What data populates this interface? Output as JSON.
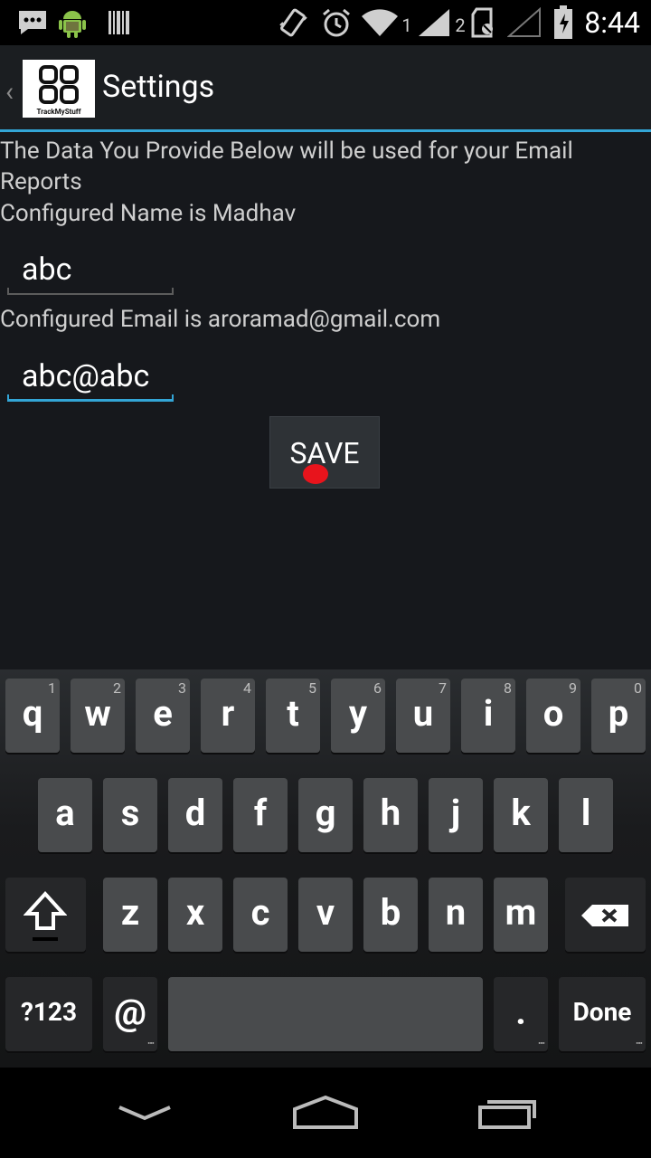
{
  "status_bar": {
    "time": "8:44",
    "sim1_label": "1",
    "sim2_label": "2",
    "icons": [
      "message-icon",
      "android-icon",
      "barcode-icon",
      "vibrate-icon",
      "alarm-icon",
      "wifi-icon",
      "signal-icon",
      "sd-card-icon",
      "no-signal-icon",
      "battery-charging-icon"
    ]
  },
  "action_bar": {
    "title": "Settings",
    "logo_text": "TrackMyStuff"
  },
  "content": {
    "intro": "The Data You Provide Below will be used for your Email Reports",
    "configured_name_line": "Configured Name is  Madhav",
    "name_value": "abc",
    "configured_email_line": "Configured Email is  aroramad@gmail.com",
    "email_value": "abc@abc",
    "save_label": "SAVE"
  },
  "keyboard": {
    "row1": [
      {
        "key": "q",
        "hint": "1"
      },
      {
        "key": "w",
        "hint": "2"
      },
      {
        "key": "e",
        "hint": "3"
      },
      {
        "key": "r",
        "hint": "4"
      },
      {
        "key": "t",
        "hint": "5"
      },
      {
        "key": "y",
        "hint": "6"
      },
      {
        "key": "u",
        "hint": "7"
      },
      {
        "key": "i",
        "hint": "8"
      },
      {
        "key": "o",
        "hint": "9"
      },
      {
        "key": "p",
        "hint": "0"
      }
    ],
    "row2": [
      "a",
      "s",
      "d",
      "f",
      "g",
      "h",
      "j",
      "k",
      "l"
    ],
    "row3": [
      "z",
      "x",
      "c",
      "v",
      "b",
      "n",
      "m"
    ],
    "symbols_label": "?123",
    "at_label": "@",
    "period_label": ".",
    "done_label": "Done"
  },
  "colors": {
    "accent": "#33a5d6",
    "touch_indicator": "#e8141c"
  }
}
